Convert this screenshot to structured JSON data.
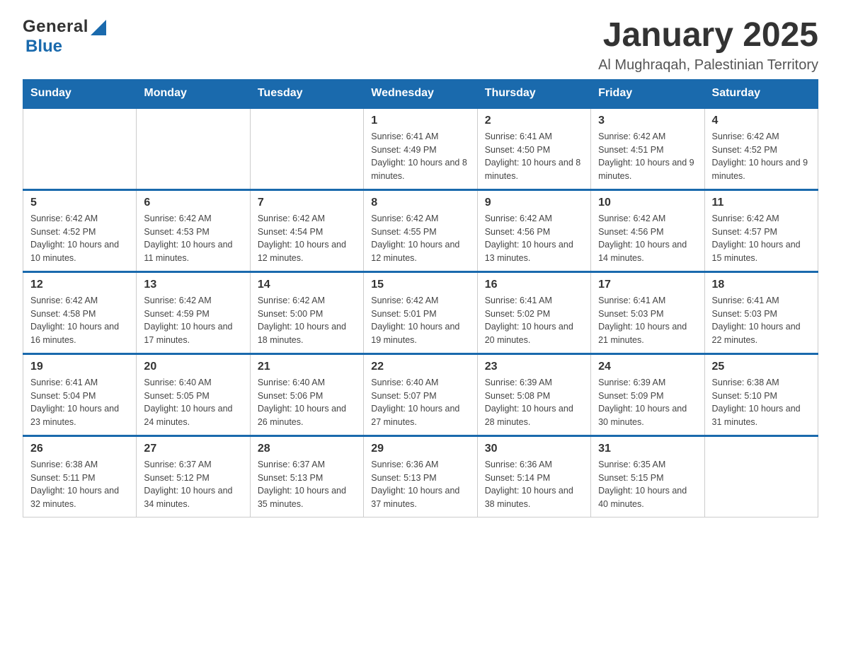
{
  "logo": {
    "general": "General",
    "blue": "Blue"
  },
  "title": "January 2025",
  "location": "Al Mughraqah, Palestinian Territory",
  "days_of_week": [
    "Sunday",
    "Monday",
    "Tuesday",
    "Wednesday",
    "Thursday",
    "Friday",
    "Saturday"
  ],
  "weeks": [
    [
      {
        "day": "",
        "info": ""
      },
      {
        "day": "",
        "info": ""
      },
      {
        "day": "",
        "info": ""
      },
      {
        "day": "1",
        "info": "Sunrise: 6:41 AM\nSunset: 4:49 PM\nDaylight: 10 hours and 8 minutes."
      },
      {
        "day": "2",
        "info": "Sunrise: 6:41 AM\nSunset: 4:50 PM\nDaylight: 10 hours and 8 minutes."
      },
      {
        "day": "3",
        "info": "Sunrise: 6:42 AM\nSunset: 4:51 PM\nDaylight: 10 hours and 9 minutes."
      },
      {
        "day": "4",
        "info": "Sunrise: 6:42 AM\nSunset: 4:52 PM\nDaylight: 10 hours and 9 minutes."
      }
    ],
    [
      {
        "day": "5",
        "info": "Sunrise: 6:42 AM\nSunset: 4:52 PM\nDaylight: 10 hours and 10 minutes."
      },
      {
        "day": "6",
        "info": "Sunrise: 6:42 AM\nSunset: 4:53 PM\nDaylight: 10 hours and 11 minutes."
      },
      {
        "day": "7",
        "info": "Sunrise: 6:42 AM\nSunset: 4:54 PM\nDaylight: 10 hours and 12 minutes."
      },
      {
        "day": "8",
        "info": "Sunrise: 6:42 AM\nSunset: 4:55 PM\nDaylight: 10 hours and 12 minutes."
      },
      {
        "day": "9",
        "info": "Sunrise: 6:42 AM\nSunset: 4:56 PM\nDaylight: 10 hours and 13 minutes."
      },
      {
        "day": "10",
        "info": "Sunrise: 6:42 AM\nSunset: 4:56 PM\nDaylight: 10 hours and 14 minutes."
      },
      {
        "day": "11",
        "info": "Sunrise: 6:42 AM\nSunset: 4:57 PM\nDaylight: 10 hours and 15 minutes."
      }
    ],
    [
      {
        "day": "12",
        "info": "Sunrise: 6:42 AM\nSunset: 4:58 PM\nDaylight: 10 hours and 16 minutes."
      },
      {
        "day": "13",
        "info": "Sunrise: 6:42 AM\nSunset: 4:59 PM\nDaylight: 10 hours and 17 minutes."
      },
      {
        "day": "14",
        "info": "Sunrise: 6:42 AM\nSunset: 5:00 PM\nDaylight: 10 hours and 18 minutes."
      },
      {
        "day": "15",
        "info": "Sunrise: 6:42 AM\nSunset: 5:01 PM\nDaylight: 10 hours and 19 minutes."
      },
      {
        "day": "16",
        "info": "Sunrise: 6:41 AM\nSunset: 5:02 PM\nDaylight: 10 hours and 20 minutes."
      },
      {
        "day": "17",
        "info": "Sunrise: 6:41 AM\nSunset: 5:03 PM\nDaylight: 10 hours and 21 minutes."
      },
      {
        "day": "18",
        "info": "Sunrise: 6:41 AM\nSunset: 5:03 PM\nDaylight: 10 hours and 22 minutes."
      }
    ],
    [
      {
        "day": "19",
        "info": "Sunrise: 6:41 AM\nSunset: 5:04 PM\nDaylight: 10 hours and 23 minutes."
      },
      {
        "day": "20",
        "info": "Sunrise: 6:40 AM\nSunset: 5:05 PM\nDaylight: 10 hours and 24 minutes."
      },
      {
        "day": "21",
        "info": "Sunrise: 6:40 AM\nSunset: 5:06 PM\nDaylight: 10 hours and 26 minutes."
      },
      {
        "day": "22",
        "info": "Sunrise: 6:40 AM\nSunset: 5:07 PM\nDaylight: 10 hours and 27 minutes."
      },
      {
        "day": "23",
        "info": "Sunrise: 6:39 AM\nSunset: 5:08 PM\nDaylight: 10 hours and 28 minutes."
      },
      {
        "day": "24",
        "info": "Sunrise: 6:39 AM\nSunset: 5:09 PM\nDaylight: 10 hours and 30 minutes."
      },
      {
        "day": "25",
        "info": "Sunrise: 6:38 AM\nSunset: 5:10 PM\nDaylight: 10 hours and 31 minutes."
      }
    ],
    [
      {
        "day": "26",
        "info": "Sunrise: 6:38 AM\nSunset: 5:11 PM\nDaylight: 10 hours and 32 minutes."
      },
      {
        "day": "27",
        "info": "Sunrise: 6:37 AM\nSunset: 5:12 PM\nDaylight: 10 hours and 34 minutes."
      },
      {
        "day": "28",
        "info": "Sunrise: 6:37 AM\nSunset: 5:13 PM\nDaylight: 10 hours and 35 minutes."
      },
      {
        "day": "29",
        "info": "Sunrise: 6:36 AM\nSunset: 5:13 PM\nDaylight: 10 hours and 37 minutes."
      },
      {
        "day": "30",
        "info": "Sunrise: 6:36 AM\nSunset: 5:14 PM\nDaylight: 10 hours and 38 minutes."
      },
      {
        "day": "31",
        "info": "Sunrise: 6:35 AM\nSunset: 5:15 PM\nDaylight: 10 hours and 40 minutes."
      },
      {
        "day": "",
        "info": ""
      }
    ]
  ]
}
